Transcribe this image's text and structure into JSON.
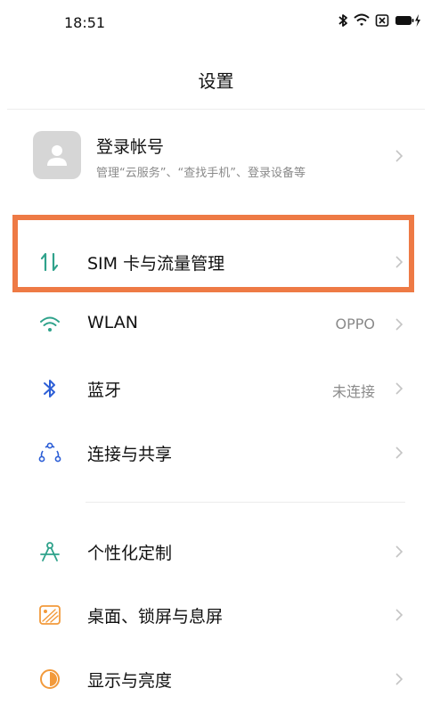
{
  "status_bar": {
    "time": "18:51"
  },
  "header": {
    "title": "设置"
  },
  "account": {
    "title": "登录帐号",
    "subtitle": "管理“云服务”、“查找手机”、登录设备等"
  },
  "rows": [
    {
      "id": "sim",
      "label": "SIM 卡与流量管理",
      "value": "",
      "icon": "sim-data-icon"
    },
    {
      "id": "wlan",
      "label": "WLAN",
      "value": "OPPO",
      "icon": "wifi-icon"
    },
    {
      "id": "bluetooth",
      "label": "蓝牙",
      "value": "未连接",
      "icon": "bluetooth-icon"
    },
    {
      "id": "connection",
      "label": "连接与共享",
      "value": "",
      "icon": "share-icon"
    },
    {
      "id": "personalization",
      "label": "个性化定制",
      "value": "",
      "icon": "compass-icon"
    },
    {
      "id": "wallpaper",
      "label": "桌面、锁屏与息屏",
      "value": "",
      "icon": "wallpaper-icon"
    },
    {
      "id": "display",
      "label": "显示与亮度",
      "value": "",
      "icon": "brightness-icon"
    }
  ],
  "colors": {
    "highlight": "#ee7a45",
    "teal": "#2fa28b",
    "blue": "#2d5fd6",
    "orange": "#f29a3b"
  }
}
